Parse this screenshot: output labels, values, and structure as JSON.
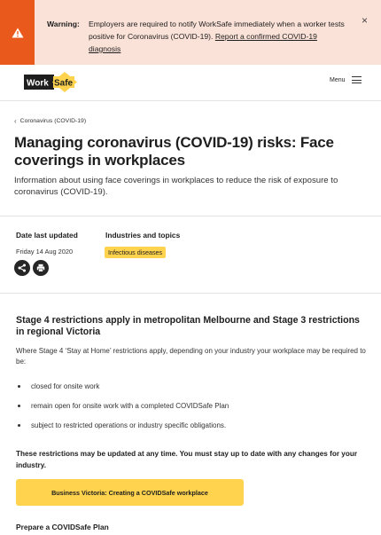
{
  "warning": {
    "label": "Warning:",
    "message": "Employers are required to notify WorkSafe immediately when a worker tests positive for Coronavirus (COVID-19).",
    "link_text": "Report a confirmed COVID-19 diagnosis",
    "close_glyph": "×",
    "accent_color": "#e9591b"
  },
  "header": {
    "logo_text_1": "Work",
    "logo_text_2": "Safe",
    "menu_label": "Menu"
  },
  "breadcrumb": {
    "chevron": "‹",
    "label": "Coronavirus (COVID-19)"
  },
  "page": {
    "title": "Managing coronavirus (COVID-19) risks: Face coverings in workplaces",
    "intro": "Information about using face coverings in workplaces to reduce the risk of exposure to coronavirus (COVID-19)."
  },
  "meta": {
    "date_label": "Date last updated",
    "date_value": "Friday 14 Aug 2020",
    "topics_label": "Industries and topics",
    "topic_tag": "Infectious diseases",
    "share_icon": "share-icon",
    "print_icon": "print-icon"
  },
  "content": {
    "heading": "Stage 4 restrictions apply in metropolitan Melbourne and Stage 3 restrictions in regional Victoria",
    "paragraph": "Where Stage 4 ‘Stay at Home’ restrictions apply, depending on your industry your workplace may be required to be:",
    "bullets": [
      "closed for onsite work",
      "remain open for onsite work with a completed COVIDSafe Plan",
      "subject to restricted operations or industry specific obligations."
    ],
    "note": "These restrictions may be updated at any time. You must stay up to date with any changes for your industry.",
    "cta_label": "Business Victoria: Creating a COVIDSafe workplace",
    "subheading": "Prepare a COVIDSafe Plan"
  },
  "colors": {
    "banner_bg": "#fbe2d8",
    "tag_yellow": "#ffd34d"
  }
}
